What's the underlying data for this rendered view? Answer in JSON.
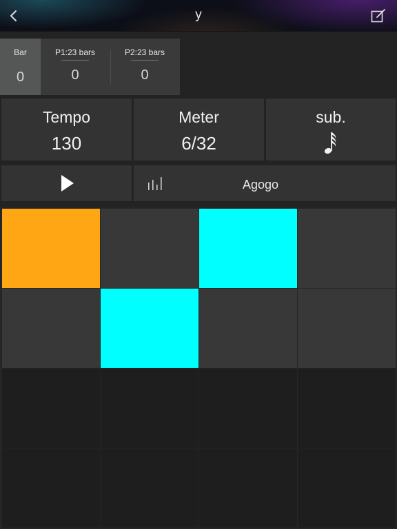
{
  "navbar": {
    "title": "y",
    "back_icon": "chevron-left-icon",
    "edit_icon": "edit-square-icon"
  },
  "counter": {
    "bar_label": "Bar",
    "bar_value": "0",
    "p1_label": "P1:23 bars",
    "p1_value": "0",
    "p2_label": "P2:23 bars",
    "p2_value": "0"
  },
  "params": {
    "tempo_label": "Tempo",
    "tempo_value": "130",
    "meter_label": "Meter",
    "meter_value": "6/32",
    "sub_label": "sub.",
    "sub_icon": "thirty-second-note-icon"
  },
  "transport": {
    "play_icon": "play-icon",
    "levels_icon": "levels-icon",
    "instrument": "Agogo"
  },
  "colors": {
    "orange": "#FFA614",
    "cyan": "#00FFFF",
    "pad_active_row": "#383838",
    "pad_inactive_row": "#1E1E1E"
  },
  "pads": [
    [
      "orange",
      "off",
      "cyan",
      "off"
    ],
    [
      "off",
      "cyan",
      "off",
      "off"
    ],
    [
      "dim",
      "dim",
      "dim",
      "dim"
    ],
    [
      "dim",
      "dim",
      "dim",
      "dim"
    ]
  ]
}
